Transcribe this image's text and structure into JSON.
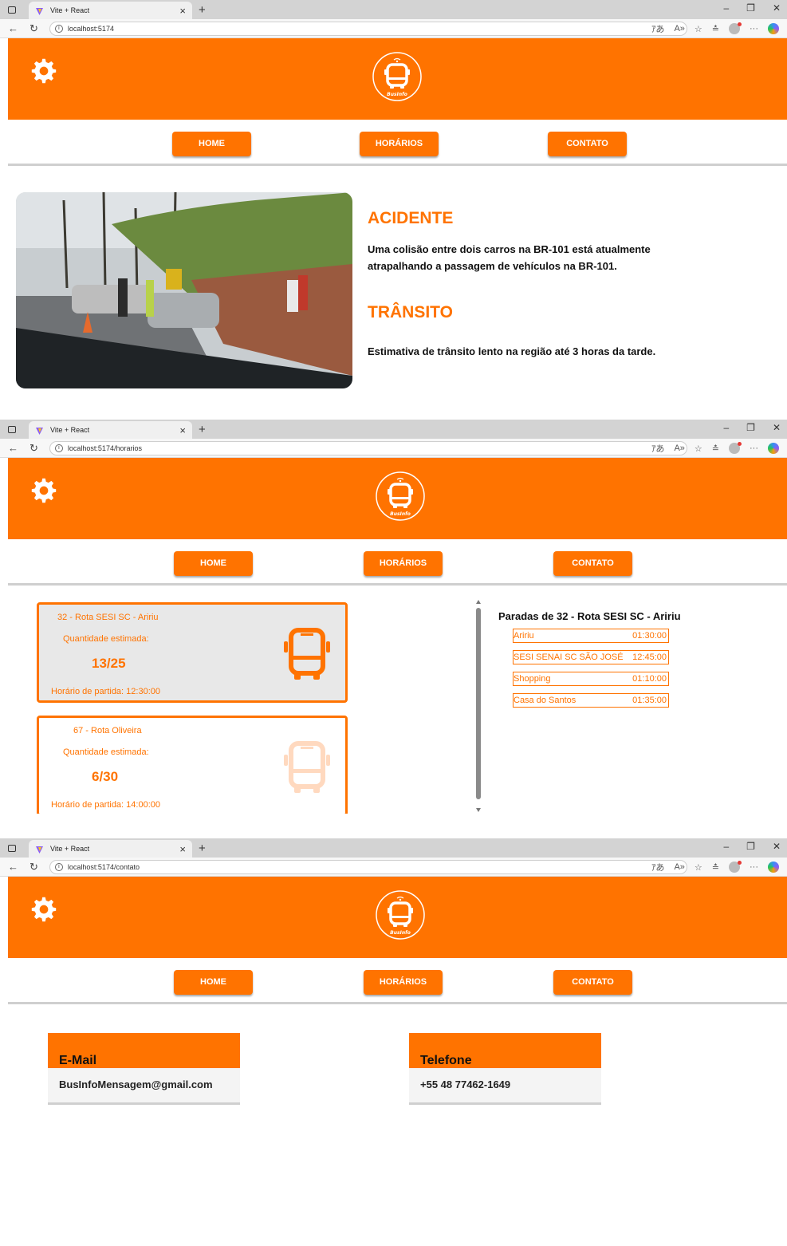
{
  "colors": {
    "brand": "#ff7300",
    "divider": "#cfcfcf"
  },
  "browser": {
    "tab_title": "Vite + React",
    "new_tab": "+",
    "close": "×"
  },
  "app": {
    "logo_text": "BusInfo",
    "nav": {
      "home": "HOME",
      "horarios": "HORÁRIOS",
      "contato": "CONTATO"
    }
  },
  "screens": [
    {
      "url": "localhost:5174"
    },
    {
      "url": "localhost:5174/horarios"
    },
    {
      "url": "localhost:5174/contato"
    }
  ],
  "home": {
    "news": [
      {
        "title": "ACIDENTE",
        "body": "Uma colisão entre dois carros na BR-101 está atualmente atrapalhando a passagem de vehículos na BR-101."
      },
      {
        "title": "TRÂNSITO",
        "body": "Estimativa de trânsito lento na região até 3 horas da tarde."
      }
    ]
  },
  "horarios": {
    "buses": [
      {
        "route": "32 - Rota SESI SC - Aririu",
        "qty_label": "Quantidade estimada:",
        "count": "13/25",
        "departure": "Horário de partida: 12:30:00"
      },
      {
        "route": "67 - Rota Oliveira",
        "qty_label": "Quantidade estimada:",
        "count": "6/30",
        "departure": "Horário de partida: 14:00:00"
      }
    ],
    "stops_title": "Paradas de 32 - Rota SESI SC - Aririu",
    "stops": [
      {
        "name": "Aririu",
        "time": "01:30:00"
      },
      {
        "name": "SESI SENAI SC SÃO JOSÉ",
        "time": "12:45:00"
      },
      {
        "name": "Shopping",
        "time": "01:10:00"
      },
      {
        "name": "Casa do Santos",
        "time": "01:35:00"
      }
    ]
  },
  "contato": {
    "email": {
      "label": "E-Mail",
      "value": "BusInfoMensagem@gmail.com"
    },
    "phone": {
      "label": "Telefone",
      "value": "+55 48 77462-1649"
    }
  }
}
